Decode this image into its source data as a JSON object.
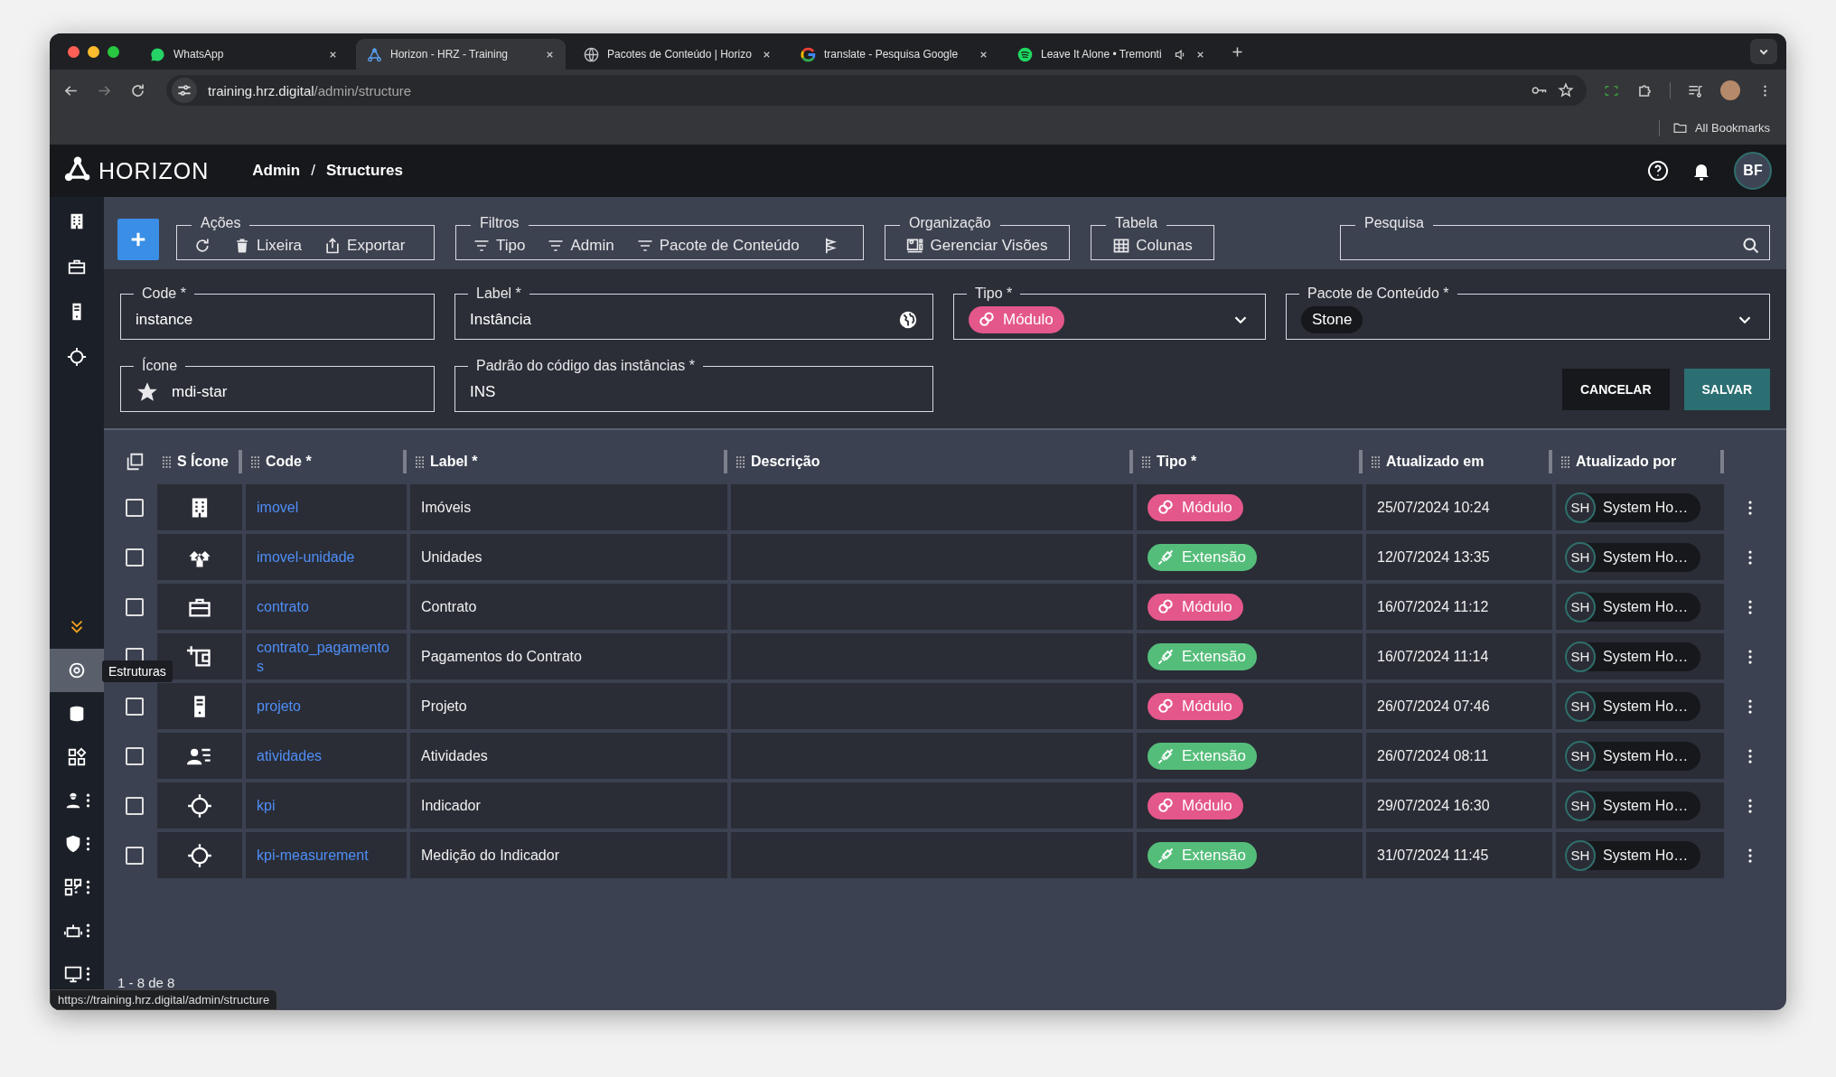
{
  "browser": {
    "tabs": [
      {
        "title": "WhatsApp",
        "kind": "whatsapp",
        "selected": false,
        "audio": false
      },
      {
        "title": "Horizon - HRZ - Training",
        "kind": "horizon",
        "selected": true,
        "audio": false
      },
      {
        "title": "Pacotes de Conteúdo | Horizo",
        "kind": "globe",
        "selected": false,
        "audio": false
      },
      {
        "title": "translate - Pesquisa Google",
        "kind": "google",
        "selected": false,
        "audio": false
      },
      {
        "title": "Leave It Alone • Tremonti",
        "kind": "spotify",
        "selected": false,
        "audio": true
      }
    ],
    "url_host": "training.hrz.digital",
    "url_path": "/admin/structure",
    "bookmarks_label": "All Bookmarks",
    "status_url": "https://training.hrz.digital/admin/structure"
  },
  "header": {
    "logo": "HORIZON",
    "breadcrumb": [
      "Admin",
      "Structures"
    ],
    "separator": "/",
    "avatar": "BF"
  },
  "sidebar": {
    "top_items": [
      {
        "kind": "building",
        "selected": false
      },
      {
        "kind": "briefcase",
        "selected": false
      },
      {
        "kind": "device",
        "selected": false
      },
      {
        "kind": "crosshair",
        "selected": false
      }
    ],
    "bottom_items": [
      {
        "kind": "chevrons",
        "selected": false,
        "menu": false
      },
      {
        "kind": "ring",
        "selected": true,
        "menu": false
      },
      {
        "kind": "database",
        "selected": false,
        "menu": false
      },
      {
        "kind": "widgets",
        "selected": false,
        "menu": false
      },
      {
        "kind": "worker",
        "selected": false,
        "menu": true
      },
      {
        "kind": "shield",
        "selected": false,
        "menu": true
      },
      {
        "kind": "qr",
        "selected": false,
        "menu": true
      },
      {
        "kind": "robot",
        "selected": false,
        "menu": true
      },
      {
        "kind": "monitor",
        "selected": false,
        "menu": true
      }
    ],
    "tooltip": "Estruturas"
  },
  "toolbar": {
    "groups": [
      {
        "label": "Ações",
        "buttons": [
          {
            "kind": "refresh"
          },
          {
            "kind": "trash",
            "label": "Lixeira"
          },
          {
            "kind": "export",
            "label": "Exportar"
          }
        ]
      },
      {
        "label": "Filtros",
        "buttons": [
          {
            "kind": "filter",
            "label": "Tipo"
          },
          {
            "kind": "filter",
            "label": "Admin"
          },
          {
            "kind": "filter",
            "label": "Pacote de Conteúdo"
          },
          {
            "kind": "barrier"
          }
        ]
      },
      {
        "label": "Organização",
        "buttons": [
          {
            "kind": "views",
            "label": "Gerenciar Visões"
          }
        ]
      },
      {
        "label": "Tabela",
        "buttons": [
          {
            "kind": "table",
            "label": "Colunas"
          }
        ]
      }
    ],
    "search_label": "Pesquisa"
  },
  "form": {
    "code": {
      "label": "Code *",
      "value": "instance"
    },
    "label": {
      "label": "Label *",
      "value": "Instância"
    },
    "tipo": {
      "label": "Tipo *",
      "value": "Módulo",
      "kind": "module"
    },
    "pacote": {
      "label": "Pacote de Conteúdo *",
      "value": "Stone"
    },
    "icone": {
      "label": "Ícone",
      "value": "mdi-star"
    },
    "padrao": {
      "label": "Padrão do código das instâncias *",
      "value": "INS"
    },
    "buttons": [
      {
        "label": "CANCELAR",
        "kind": "secondary"
      },
      {
        "label": "SALVAR",
        "kind": "primary"
      }
    ]
  },
  "table": {
    "columns": [
      "S Ícone",
      "Code *",
      "Label *",
      "Descrição",
      "Tipo *",
      "Atualizado em",
      "Atualizado por"
    ],
    "rows": [
      {
        "checked": false,
        "code": "imovel",
        "label": "Imóveis",
        "tipo": "Módulo",
        "kind": "module",
        "updated": "25/07/2024 10:24",
        "user_initials": "SH",
        "user": "System Ho…"
      },
      {
        "checked": false,
        "code": "imovel-unidade",
        "label": "Unidades",
        "tipo": "Extensão",
        "kind": "extension",
        "updated": "12/07/2024 13:35",
        "user_initials": "SH",
        "user": "System Ho…"
      },
      {
        "checked": false,
        "code": "contrato",
        "label": "Contrato",
        "tipo": "Módulo",
        "kind": "module",
        "updated": "16/07/2024 11:12",
        "user_initials": "SH",
        "user": "System Ho…"
      },
      {
        "checked": false,
        "code": "contrato_pagamentos",
        "label": "Pagamentos do Contrato",
        "tipo": "Extensão",
        "kind": "extension",
        "updated": "16/07/2024 11:14",
        "user_initials": "SH",
        "user": "System Ho…"
      },
      {
        "checked": false,
        "code": "projeto",
        "label": "Projeto",
        "tipo": "Módulo",
        "kind": "module",
        "updated": "26/07/2024 07:46",
        "user_initials": "SH",
        "user": "System Ho…"
      },
      {
        "checked": false,
        "code": "atividades",
        "label": "Atividades",
        "tipo": "Extensão",
        "kind": "extension",
        "updated": "26/07/2024 08:11",
        "user_initials": "SH",
        "user": "System Ho…"
      },
      {
        "checked": false,
        "code": "kpi",
        "label": "Indicador",
        "tipo": "Módulo",
        "kind": "module",
        "updated": "29/07/2024 16:30",
        "user_initials": "SH",
        "user": "System Ho…"
      },
      {
        "checked": false,
        "code": "kpi-measurement",
        "label": "Medição do Indicador",
        "tipo": "Extensão",
        "kind": "extension",
        "updated": "31/07/2024 11:45",
        "user_initials": "SH",
        "user": "System Ho…"
      }
    ],
    "pagination": "1 - 8 de 8"
  }
}
